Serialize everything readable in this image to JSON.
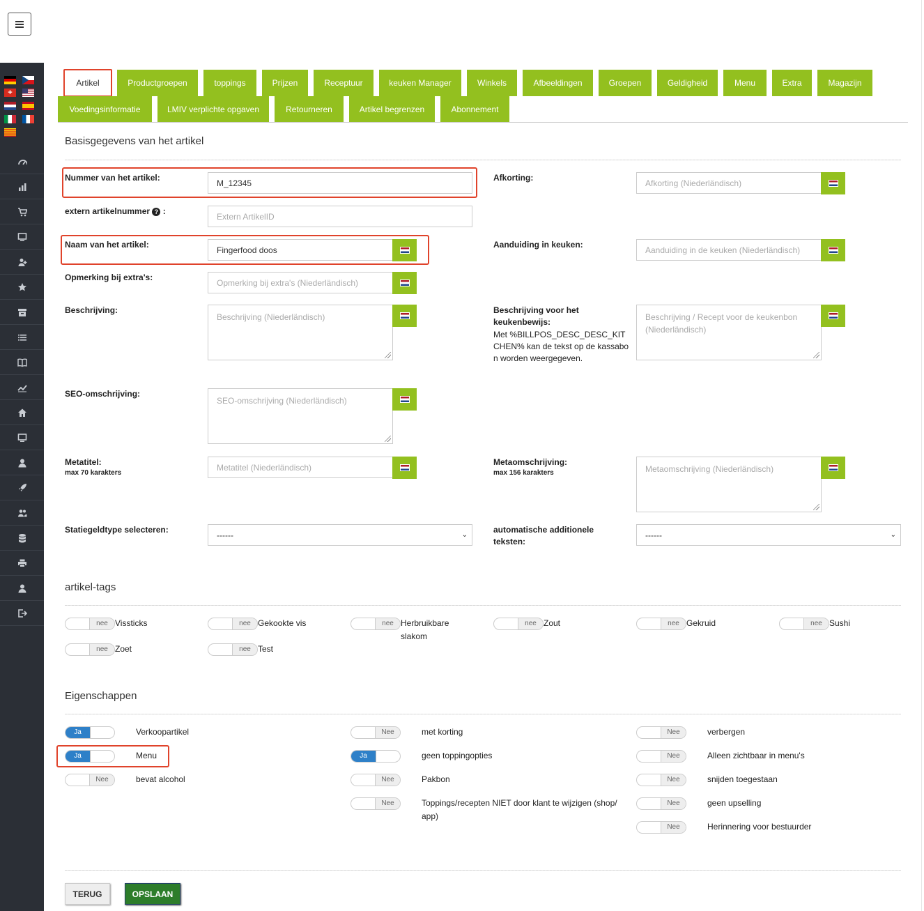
{
  "tabs_row1": [
    "Artikel",
    "Productgroepen",
    "toppings",
    "Prijzen",
    "Receptuur",
    "keuken Manager",
    "Winkels",
    "Afbeeldingen",
    "Groepen",
    "Geldigheid",
    "Menu",
    "Extra",
    "Magazijn"
  ],
  "tabs_row2": [
    "Voedingsinformatie",
    "LMIV verplichte opgaven",
    "Retourneren",
    "Artikel begrenzen",
    "Abonnement"
  ],
  "basis": {
    "title": "Basisgegevens van het artikel",
    "nummer_label": "Nummer van het artikel:",
    "nummer_value": "M_12345",
    "extern_label": "extern artikelnummer",
    "extern_help": "?",
    "extern_colon": ":",
    "extern_placeholder": "Extern ArtikelID",
    "naam_label": "Naam van het artikel:",
    "naam_value": "Fingerfood doos",
    "opmerking_label": "Opmerking bij extra's:",
    "opmerking_placeholder": "Opmerking bij extra's (Niederländisch)",
    "beschrijving_label": "Beschrijving:",
    "beschrijving_placeholder": "Beschrijving (Niederländisch)",
    "seo_label": "SEO-omschrijving:",
    "seo_placeholder": "SEO-omschrijving (Niederländisch)",
    "metatitel_label": "Metatitel:",
    "metatitel_sub": "max 70 karakters",
    "metatitel_placeholder": "Metatitel (Niederländisch)",
    "statiegeld_label": "Statiegeldtype selecteren:",
    "statiegeld_value": "------",
    "afkorting_label": "Afkorting:",
    "afkorting_placeholder": "Afkorting (Niederländisch)",
    "aanduiding_label": "Aanduiding in keuken:",
    "aanduiding_placeholder": "Aanduiding in de keuken (Niederländisch)",
    "keukenbewijs_label": "Beschrijving voor het keukenbewijs:",
    "keukenbewijs_note": "Met %BILLPOS_DESC_DESC_KITCHEN% kan de tekst op de kassabon worden weergegeven.",
    "keukenbewijs_placeholder": "Beschrijving / Recept voor de keukenbon (Niederländisch)",
    "metaomschrijving_label": "Metaomschrijving:",
    "metaomschrijving_sub": "max 156 karakters",
    "metaomschrijving_placeholder": "Metaomschrijving (Niederländisch)",
    "additionele_label": "automatische additionele teksten:",
    "additionele_value": "------"
  },
  "tags": {
    "title": "artikel-tags",
    "off_label": "nee",
    "items": [
      "Vissticks",
      "Gekookte vis",
      "Herbruikbare slakom",
      "Zout",
      "Gekruid",
      "Sushi",
      "Zoet",
      "Test"
    ]
  },
  "props": {
    "title": "Eigenschappen",
    "on_label": "Ja",
    "off_label": "Nee",
    "col1": [
      "Verkoopartikel",
      "Menu",
      "bevat alcohol"
    ],
    "col2": [
      "met korting",
      "geen toppingopties",
      "Pakbon",
      "Toppings/recepten NIET door klant te wijzigen (shop/ app)"
    ],
    "col3": [
      "verbergen",
      "Alleen zichtbaar in menu's",
      "snijden toegestaan",
      "geen upselling",
      "Herinnering voor bestuurder"
    ]
  },
  "buttons": {
    "back": "TERUG",
    "save": "OPSLAAN"
  },
  "colors": {
    "accent": "#93c01f",
    "highlight": "#e0432b",
    "toggle_on": "#2e80c8",
    "save": "#2d7d2a",
    "sidebar": "#2b2f36"
  },
  "sidebar_icons": [
    "dashboard-icon",
    "chart-icon",
    "cart-icon",
    "monitor-icon",
    "user-plus-icon",
    "star-icon",
    "archive-icon",
    "list-icon",
    "book-icon",
    "trend-icon",
    "home-icon",
    "desktop-icon",
    "user-icon",
    "rocket-icon",
    "users-icon",
    "database-icon",
    "printer-icon",
    "account-icon",
    "logout-icon"
  ]
}
